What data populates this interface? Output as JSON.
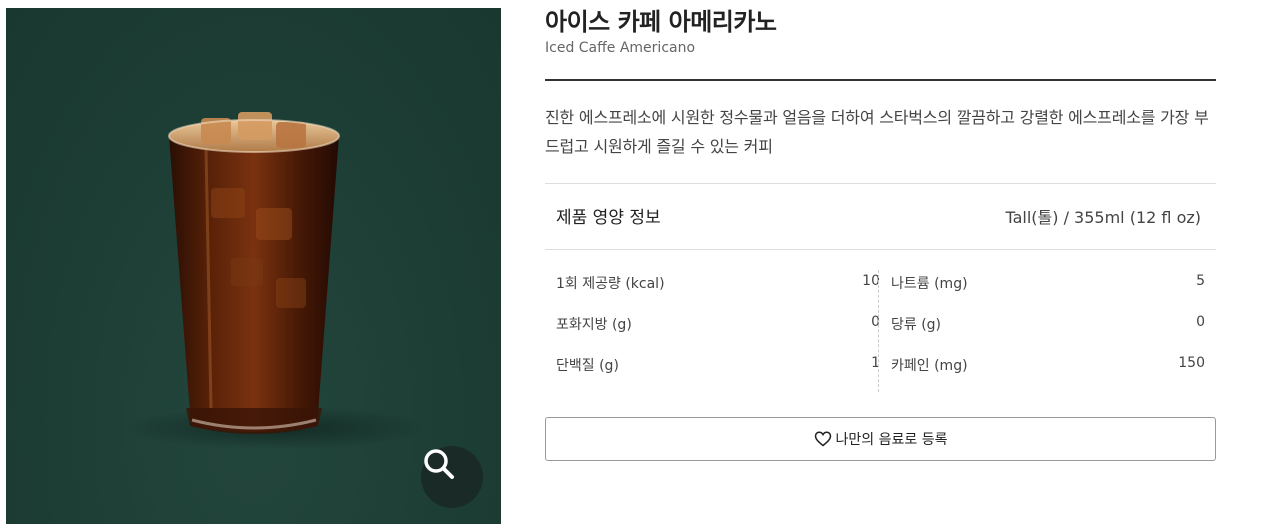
{
  "product": {
    "name_ko": "아이스 카페 아메리카노",
    "name_en": "Iced Caffe Americano",
    "description": "진한 에스프레소에 시원한 정수물과 얼음을 더하여 스타벅스의 깔끔하고 강렬한 에스프레소를 가장 부드럽고 시원하게 즐길 수 있는 커피"
  },
  "nutrition": {
    "heading": "제품 영양 정보",
    "size": "Tall(톨) / 355ml (12 fl oz)",
    "left": [
      {
        "label": "1회 제공량 (kcal)",
        "value": "10"
      },
      {
        "label": "포화지방 (g)",
        "value": "0"
      },
      {
        "label": "단백질 (g)",
        "value": "1"
      }
    ],
    "right": [
      {
        "label": "나트륨 (mg)",
        "value": "5"
      },
      {
        "label": "당류 (g)",
        "value": "0"
      },
      {
        "label": "카페인 (mg)",
        "value": "150"
      }
    ]
  },
  "actions": {
    "favorite_label": "나만의 음료로 등록"
  },
  "icons": {
    "zoom": "search-icon",
    "favorite": "heart-icon"
  },
  "colors": {
    "photo_background": "#1d3e35",
    "zoom_button": "#1a2a26"
  }
}
